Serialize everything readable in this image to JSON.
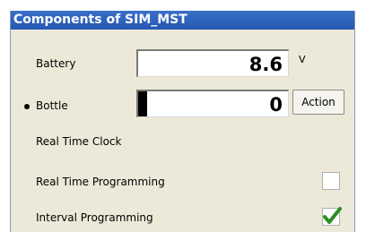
{
  "panel": {
    "title": "Components of SIM_MST"
  },
  "battery": {
    "label": "Battery",
    "value": "8.6",
    "unit": "V"
  },
  "bottle": {
    "label": "Bottle",
    "value": "0",
    "level_fraction": 0.06,
    "action_label": "Action",
    "bullet_icon": "bullet-icon"
  },
  "real_time_clock": {
    "label": "Real Time Clock"
  },
  "real_time_programming": {
    "label": "Real Time Programming",
    "checked": false
  },
  "interval_programming": {
    "label": "Interval Programming",
    "checked": true,
    "check_icon": "checkmark-icon",
    "check_color": "#2e8b22"
  },
  "colors": {
    "title_bar": "#2557b3",
    "panel_bg": "#ece9d8"
  }
}
